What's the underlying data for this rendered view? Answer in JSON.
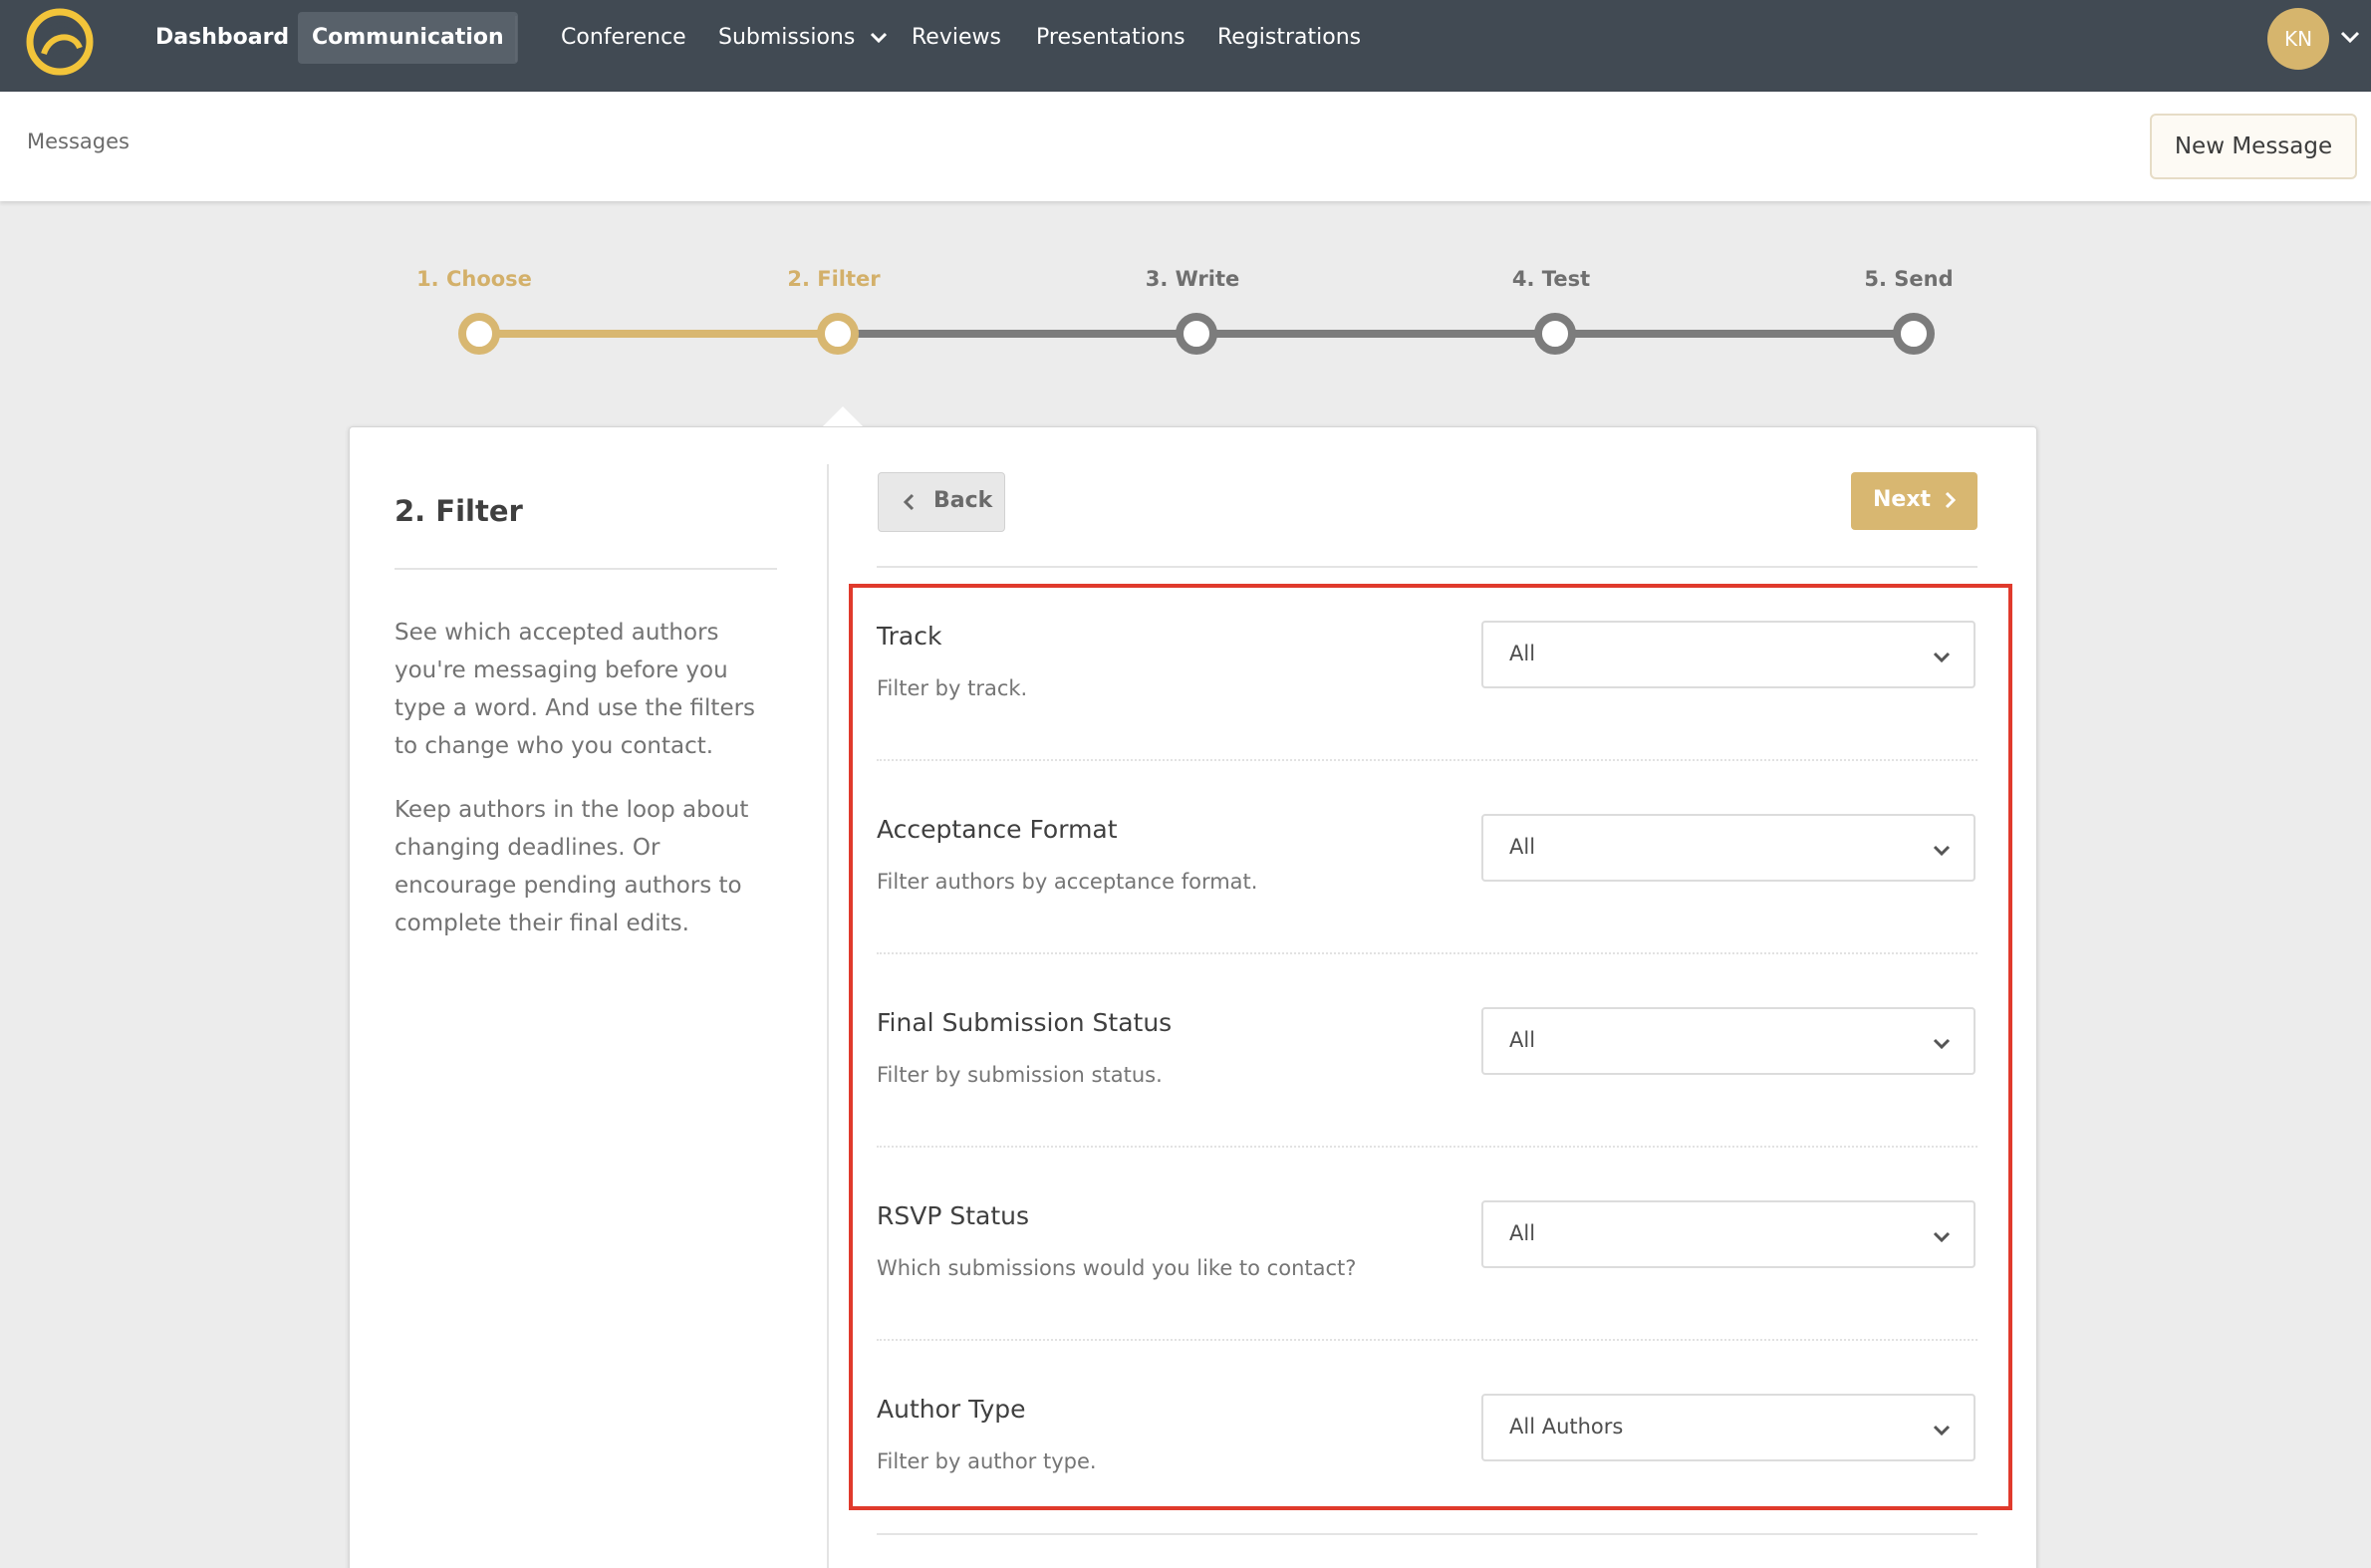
{
  "nav": {
    "logo_icon": "spiral-logo",
    "items": [
      {
        "label": "Dashboard"
      },
      {
        "label": "Communication"
      },
      {
        "label": "Conference"
      },
      {
        "label": "Submissions"
      },
      {
        "label": "Reviews"
      },
      {
        "label": "Presentations"
      },
      {
        "label": "Registrations"
      }
    ],
    "avatar_initials": "KN"
  },
  "header": {
    "breadcrumb": "Messages",
    "new_message_label": "New Message"
  },
  "stepper": {
    "steps": [
      {
        "label": "1. Choose",
        "state": "done"
      },
      {
        "label": "2. Filter",
        "state": "current"
      },
      {
        "label": "3. Write",
        "state": "todo"
      },
      {
        "label": "4. Test",
        "state": "todo"
      },
      {
        "label": "5. Send",
        "state": "todo"
      }
    ]
  },
  "sidebar": {
    "title": "2. Filter",
    "paragraphs": [
      "See which accepted authors you're messaging before you type a word. And use the filters to change who you contact.",
      "Keep authors in the loop about changing deadlines. Or encourage pending authors to complete their final edits."
    ]
  },
  "actions": {
    "back_label": "Back",
    "next_label": "Next"
  },
  "filters": [
    {
      "title": "Track",
      "description": "Filter by track.",
      "value": "All"
    },
    {
      "title": "Acceptance Format",
      "description": "Filter authors by acceptance format.",
      "value": "All"
    },
    {
      "title": "Final Submission Status",
      "description": "Filter by submission status.",
      "value": "All"
    },
    {
      "title": "RSVP Status",
      "description": "Which submissions would you like to contact?",
      "value": "All"
    },
    {
      "title": "Author Type",
      "description": "Filter by author type.",
      "value": "All Authors"
    }
  ],
  "colors": {
    "accent": "#d8b771",
    "nav_bg": "#414a53",
    "highlight": "#e03a2c"
  }
}
